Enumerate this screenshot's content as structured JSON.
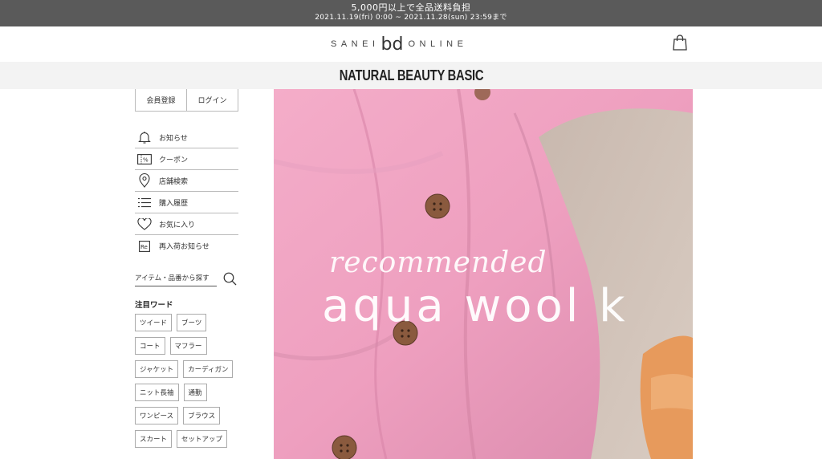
{
  "promo": {
    "line1": "5,000円以上で全品送料負担",
    "line2": "2021.11.19(fri) 0:00 ~ 2021.11.28(sun) 23:59まで"
  },
  "header": {
    "logo_left": "SANEI",
    "logo_mid": "bd",
    "logo_right": "ONLINE",
    "cart_icon": "shopping-bag-icon"
  },
  "brand": {
    "name": "NATURAL BEAUTY BASIC"
  },
  "sidebar": {
    "register_label": "会員登録",
    "login_label": "ログイン",
    "menu": [
      {
        "label": "お知らせ",
        "icon": "bell-icon"
      },
      {
        "label": "クーポン",
        "icon": "coupon-icon"
      },
      {
        "label": "店舗検索",
        "icon": "location-pin-icon"
      },
      {
        "label": "購入履歴",
        "icon": "list-icon"
      },
      {
        "label": "お気に入り",
        "icon": "heart-icon"
      },
      {
        "label": "再入荷お知らせ",
        "icon": "restock-icon"
      }
    ],
    "search_placeholder": "アイテム・品番から探す",
    "search_icon": "search-icon",
    "hot_words_title": "注目ワード",
    "hot_words": [
      "ツイード",
      "ブーツ",
      "コート",
      "マフラー",
      "ジャケット",
      "カーディガン",
      "ニット長袖",
      "通勤",
      "ワンピース",
      "ブラウス",
      "スカート",
      "セットアップ"
    ]
  },
  "hero": {
    "script_text": "recommended",
    "title_text": "aqua wool k"
  },
  "colors": {
    "promo_bg": "#5a5a5a",
    "brand_bar_bg": "#f3f3f3",
    "hero_pink": "#ee9fbf",
    "hero_beige": "#cbbcb0",
    "hero_orange": "#e79a5c"
  }
}
